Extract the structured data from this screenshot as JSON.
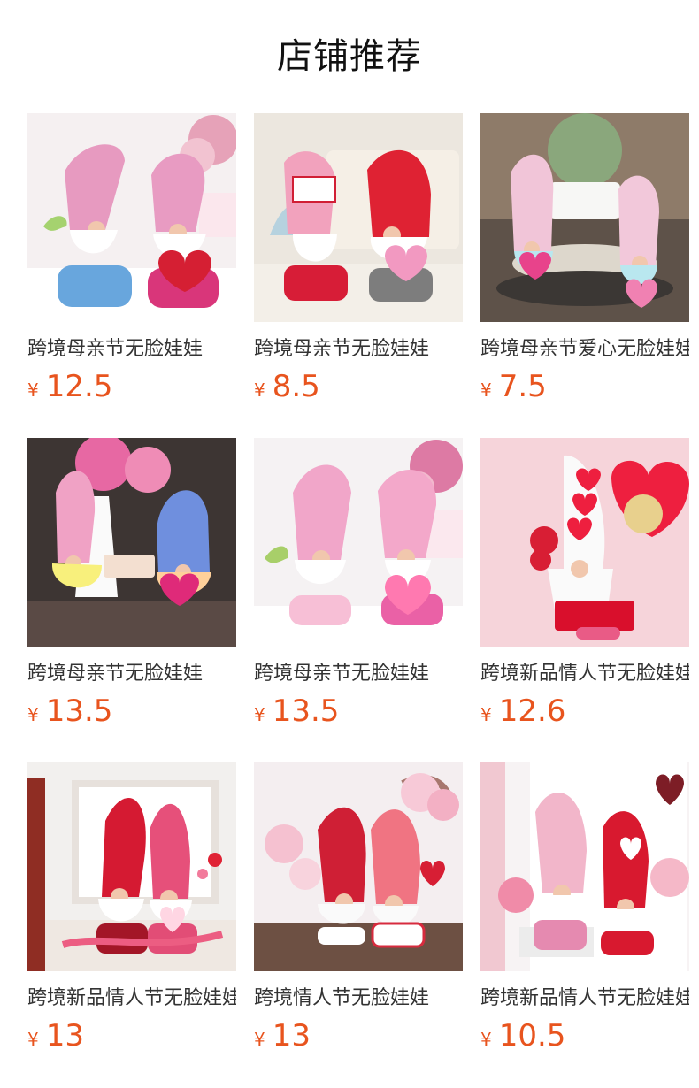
{
  "section": {
    "title": "店铺推荐"
  },
  "currency_symbol": "¥",
  "products": [
    {
      "title": "跨境母亲节无脸娃娃",
      "price": "12.5",
      "image": "pink-gnome-pair-tulips-best-mom-heart"
    },
    {
      "title": "跨境母亲节无脸娃娃",
      "price": "8.5",
      "image": "red-gnome-pair-i-love-mom-sign"
    },
    {
      "title": "跨境母亲节爱心无脸娃娃",
      "price": "7.5",
      "image": "pink-gnomes-tiered-tray-love-you-mom"
    },
    {
      "title": "跨境母亲节无脸娃娃",
      "price": "13.5",
      "image": "glowing-gnomes-happy-mothers-day-tag"
    },
    {
      "title": "跨境母亲节无脸娃娃",
      "price": "13.5",
      "image": "pink-gnome-pair-tulips-best-mom-heart"
    },
    {
      "title": "跨境新品情人节无脸娃娃",
      "price": "12.6",
      "image": "white-heart-gnome-love-sign"
    },
    {
      "title": "跨境新品情人节无脸娃娃",
      "price": "13",
      "image": "valentine-gnome-pair-heart-frame"
    },
    {
      "title": "跨境情人节无脸娃娃",
      "price": "13",
      "image": "red-gnome-pair-love-gift-boxes"
    },
    {
      "title": "跨境新品情人节无脸娃娃",
      "price": "10.5",
      "image": "pink-red-gnome-pair-plaid-heart"
    }
  ],
  "colors": {
    "price": "#e8541e",
    "title": "#111111",
    "product_title": "#333333"
  }
}
